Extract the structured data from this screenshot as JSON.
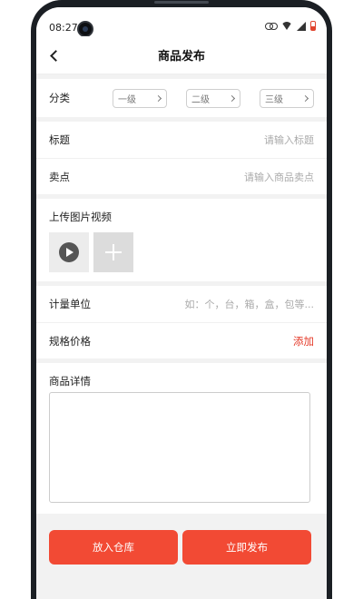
{
  "status": {
    "time": "08:27"
  },
  "nav": {
    "title": "商品发布"
  },
  "category": {
    "label": "分类",
    "levels": [
      {
        "label": "一级"
      },
      {
        "label": "二级"
      },
      {
        "label": "三级"
      }
    ]
  },
  "title_field": {
    "label": "标题",
    "placeholder": "请输入标题"
  },
  "selling_point": {
    "label": "卖点",
    "placeholder": "请输入商品卖点"
  },
  "upload": {
    "label": "上传图片视频"
  },
  "unit": {
    "label": "计量单位",
    "placeholder": "如：个，台，箱，盒，包等..."
  },
  "spec": {
    "label": "规格价格",
    "action": "添加"
  },
  "detail": {
    "label": "商品详情"
  },
  "actions": {
    "warehouse": "放入仓库",
    "publish": "立即发布"
  },
  "colors": {
    "accent": "#f24a34",
    "link": "#e53b2a"
  }
}
